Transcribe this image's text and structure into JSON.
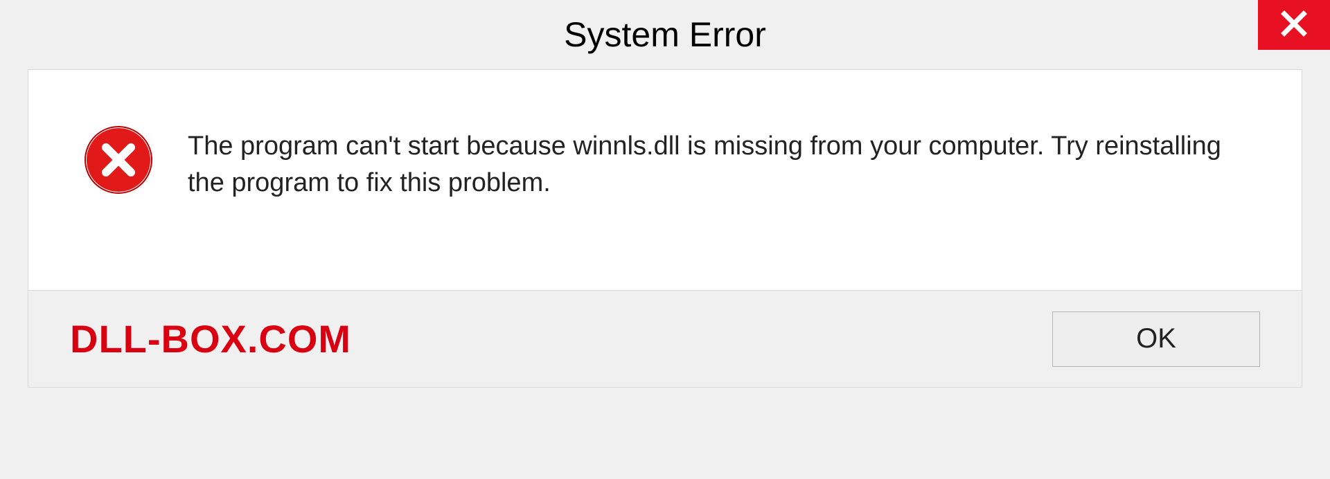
{
  "titlebar": {
    "title": "System Error"
  },
  "dialog": {
    "message": "The program can't start because winnls.dll is missing from your computer. Try reinstalling the program to fix this problem."
  },
  "footer": {
    "watermark": "DLL-BOX.COM",
    "ok_label": "OK"
  },
  "colors": {
    "close_bg": "#e81123",
    "error_icon": "#e11919",
    "watermark": "#d90012"
  }
}
